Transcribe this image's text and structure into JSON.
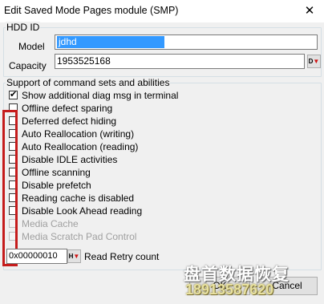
{
  "window": {
    "title": "Edit Saved Mode Pages module (SMP)",
    "close_glyph": "✕"
  },
  "hdd_id": {
    "legend": "HDD ID",
    "model_label": "Model",
    "model_value": "jdhd",
    "capacity_label": "Capacity",
    "capacity_value": "1953525168",
    "capacity_button_text": "D",
    "capacity_button_icon": "down-arrow-icon"
  },
  "support": {
    "legend": "Support of command sets and abilities",
    "items": [
      {
        "label": "Show additional diag msg in terminal",
        "checked": true,
        "enabled": true
      },
      {
        "label": "Offline defect sparing",
        "checked": false,
        "enabled": true
      },
      {
        "label": "Deferred defect hiding",
        "checked": false,
        "enabled": true
      },
      {
        "label": "Auto Reallocation (writing)",
        "checked": false,
        "enabled": true
      },
      {
        "label": "Auto Reallocation (reading)",
        "checked": false,
        "enabled": true
      },
      {
        "label": "Disable IDLE activities",
        "checked": false,
        "enabled": true
      },
      {
        "label": "Offline scanning",
        "checked": false,
        "enabled": true
      },
      {
        "label": "Disable prefetch",
        "checked": false,
        "enabled": true
      },
      {
        "label": "Reading cache is disabled",
        "checked": false,
        "enabled": true
      },
      {
        "label": "Disable Look Ahead reading",
        "checked": false,
        "enabled": true
      },
      {
        "label": "Media Cache",
        "checked": false,
        "enabled": false
      },
      {
        "label": "Media Scratch Pad Control",
        "checked": false,
        "enabled": false
      }
    ],
    "read_retry": {
      "value": "0x00000010",
      "button_text": "H",
      "label": "Read Retry count"
    }
  },
  "buttons": {
    "ok": "OK",
    "cancel": "Cancel"
  },
  "watermark": {
    "text_cn": "盘首数据恢复",
    "phone": "18913587620"
  },
  "colors": {
    "highlight": "#c51c1c",
    "selection": "#3399ff",
    "dialog_bg": "#f0f0f0"
  }
}
